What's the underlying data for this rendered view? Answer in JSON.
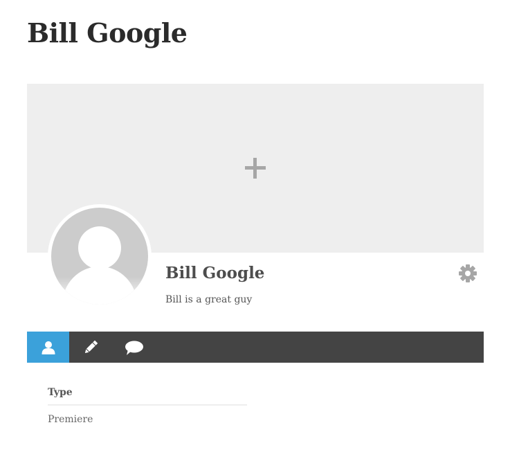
{
  "page": {
    "title": "Bill Google"
  },
  "profile": {
    "name": "Bill Google",
    "bio": "Bill is a great guy"
  },
  "tabs": [
    {
      "icon": "user-icon",
      "active": true
    },
    {
      "icon": "pencil-icon",
      "active": false
    },
    {
      "icon": "comment-icon",
      "active": false
    }
  ],
  "about": {
    "fields": [
      {
        "label": "Type",
        "value": "Premiere"
      }
    ]
  },
  "colors": {
    "accent": "#3ba1da",
    "tabbar": "#444444",
    "cover": "#eeeeee",
    "icon_gray": "#a6a6a6"
  }
}
